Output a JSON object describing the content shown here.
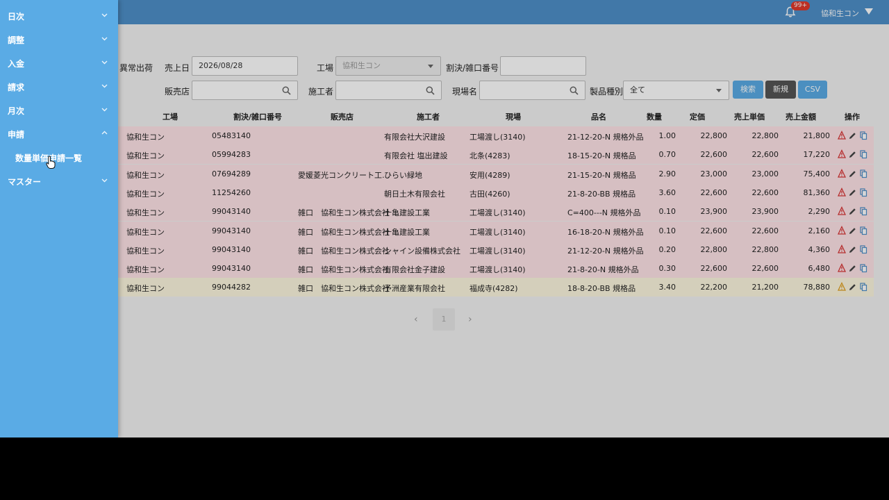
{
  "header": {
    "notification_badge": "99+",
    "user_name": "協和生コン",
    "icons": [
      "bell-icon",
      "caret-down-icon"
    ]
  },
  "sidebar": {
    "items": [
      {
        "label": "日次",
        "expanded": false
      },
      {
        "label": "調整",
        "expanded": false
      },
      {
        "label": "入金",
        "expanded": false
      },
      {
        "label": "請求",
        "expanded": false
      },
      {
        "label": "月次",
        "expanded": false
      },
      {
        "label": "申請",
        "expanded": true
      },
      {
        "label": "マスター",
        "expanded": false
      }
    ],
    "submenu": {
      "label": "数量単価申請一覧"
    }
  },
  "filters": {
    "abnormal_label": "異常出荷",
    "sales_date_label": "売上日",
    "sales_date_value": "2026/08/28",
    "factory_label": "工場",
    "factory_value": "協和生コン",
    "split_no_label": "割決/雑口番号",
    "split_no_value": "",
    "dealer_label": "販売店",
    "dealer_value": "",
    "contractor_label": "施工者",
    "contractor_value": "",
    "site_label": "現場名",
    "site_value": "",
    "product_type_label": "製品種別",
    "product_type_value": "全て"
  },
  "buttons": {
    "search": "検索",
    "new": "新規",
    "csv": "CSV"
  },
  "colors": {
    "header": "#4e8fc9",
    "sidebar": "#5aabe5",
    "row_alert": "#ffe4e8",
    "row_warn": "#fdf7df",
    "btn_search": "#5aabe5",
    "btn_new": "#555555",
    "btn_csv": "#5aabe5"
  },
  "table": {
    "columns": [
      "工場",
      "割決/雑口番号",
      "販売店",
      "施工者",
      "現場",
      "品名",
      "数量",
      "定価",
      "売上単価",
      "売上金額",
      "操作"
    ],
    "rows": [
      {
        "factory": "協和生コン",
        "split_no": "05483140",
        "dealer": "",
        "contractor": "有限会社大沢建設",
        "site": "工場渡し(3140)",
        "product": "21-12-20-N 規格外品",
        "qty": "1.00",
        "list_price": "22,800",
        "unit_price": "22,800",
        "amount": "21,800",
        "status": "alert"
      },
      {
        "factory": "協和生コン",
        "split_no": "05994283",
        "dealer": "",
        "contractor": "有限会社 塩出建設",
        "site": "北条(4283)",
        "product": "18-15-20-N 規格品",
        "qty": "0.70",
        "list_price": "22,600",
        "unit_price": "22,600",
        "amount": "17,220",
        "status": "alert"
      },
      {
        "factory": "協和生コン",
        "split_no": "07694289",
        "dealer": "愛媛菱光コンクリート工…",
        "contractor": "ひらい緑地",
        "site": "安用(4289)",
        "product": "21-15-20-N 規格品",
        "qty": "2.90",
        "list_price": "23,000",
        "unit_price": "23,000",
        "amount": "75,400",
        "status": "alert"
      },
      {
        "factory": "協和生コン",
        "split_no": "11254260",
        "dealer": "",
        "contractor": "朝日土木有限会社",
        "site": "古田(4260)",
        "product": "21-8-20-BB 規格品",
        "qty": "3.60",
        "list_price": "22,600",
        "unit_price": "22,600",
        "amount": "81,360",
        "status": "alert"
      },
      {
        "factory": "協和生コン",
        "split_no": "99043140",
        "dealer": "雑口　協和生コン株式会社",
        "contractor": "十亀建設工業",
        "site": "工場渡し(3140)",
        "product": "C=400---N 規格外品",
        "qty": "0.10",
        "list_price": "23,900",
        "unit_price": "23,900",
        "amount": "2,290",
        "status": "alert"
      },
      {
        "factory": "協和生コン",
        "split_no": "99043140",
        "dealer": "雑口　協和生コン株式会社",
        "contractor": "十亀建設工業",
        "site": "工場渡し(3140)",
        "product": "16-18-20-N 規格外品",
        "qty": "0.10",
        "list_price": "22,600",
        "unit_price": "22,600",
        "amount": "2,160",
        "status": "alert"
      },
      {
        "factory": "協和生コン",
        "split_no": "99043140",
        "dealer": "雑口　協和生コン株式会社",
        "contractor": "シャイン設備株式会社",
        "site": "工場渡し(3140)",
        "product": "21-12-20-N 規格外品",
        "qty": "0.20",
        "list_price": "22,800",
        "unit_price": "22,800",
        "amount": "4,360",
        "status": "alert"
      },
      {
        "factory": "協和生コン",
        "split_no": "99043140",
        "dealer": "雑口　協和生コン株式会社",
        "contractor": "有限会社金子建設",
        "site": "工場渡し(3140)",
        "product": "21-8-20-N 規格外品",
        "qty": "0.30",
        "list_price": "22,600",
        "unit_price": "22,600",
        "amount": "6,480",
        "status": "alert"
      },
      {
        "factory": "協和生コン",
        "split_no": "99044282",
        "dealer": "雑口　協和生コン株式会社",
        "contractor": "予洲産業有限会社",
        "site": "福成寺(4282)",
        "product": "18-8-20-BB 規格品",
        "qty": "3.40",
        "list_price": "22,200",
        "unit_price": "21,200",
        "amount": "78,880",
        "status": "warn"
      }
    ]
  },
  "pagination": {
    "prev": "‹",
    "current": "1",
    "next": "›"
  }
}
